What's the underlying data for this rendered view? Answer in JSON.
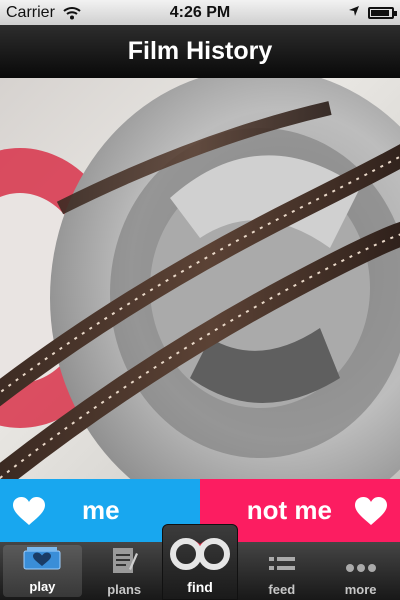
{
  "status_bar": {
    "carrier": "Carrier",
    "time": "4:26 PM",
    "battery_level": 0.9
  },
  "nav": {
    "title": "Film History"
  },
  "hero": {
    "icon": "film-reel-photo"
  },
  "choices": {
    "me_label": "me",
    "not_me_label": "not me",
    "me_color": "#18a7ef",
    "not_me_color": "#fc1d61"
  },
  "tabs": [
    {
      "label": "play",
      "icon": "play-heart-icon",
      "active": true
    },
    {
      "label": "plans",
      "icon": "notepad-icon",
      "active": false
    },
    {
      "label": "find",
      "icon": "binoculars-icon",
      "active": false
    },
    {
      "label": "feed",
      "icon": "list-icon",
      "active": false
    },
    {
      "label": "more",
      "icon": "dots-icon",
      "active": false
    }
  ]
}
